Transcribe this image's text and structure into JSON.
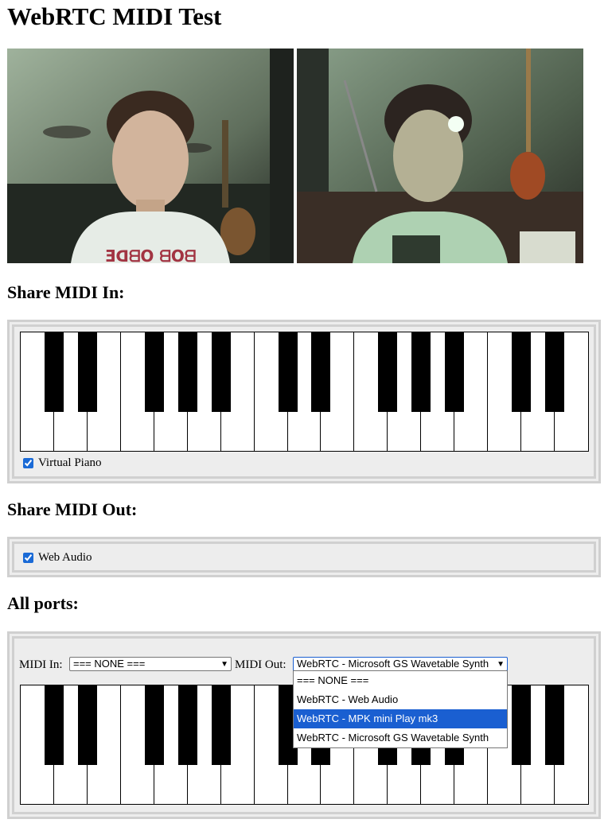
{
  "title": "WebRTC MIDI Test",
  "sections": {
    "midi_in_heading": "Share MIDI In:",
    "midi_out_heading": "Share MIDI Out:",
    "all_ports_heading": "All ports:"
  },
  "videos": [
    {
      "name": "local-video",
      "description_icon": "video-feed"
    },
    {
      "name": "remote-video",
      "description_icon": "video-feed"
    }
  ],
  "midi_in": {
    "virtual_piano_label": "Virtual Piano",
    "virtual_piano_checked": true
  },
  "midi_out": {
    "web_audio_label": "Web Audio",
    "web_audio_checked": true
  },
  "ports": {
    "midi_in_label": "MIDI In:",
    "midi_in_value": "=== NONE ===",
    "midi_out_label": "MIDI Out:",
    "midi_out_value": "WebRTC - Microsoft GS Wavetable Synth",
    "midi_out_options": [
      "=== NONE ===",
      "WebRTC - Web Audio",
      "WebRTC - MPK mini Play mk3",
      "WebRTC - Microsoft GS Wavetable Synth"
    ],
    "highlighted_option": "WebRTC - MPK mini Play mk3"
  },
  "colors": {
    "accent": "#1a5fd1",
    "panel_bg": "#ededed",
    "panel_border": "#d0d0d0"
  }
}
